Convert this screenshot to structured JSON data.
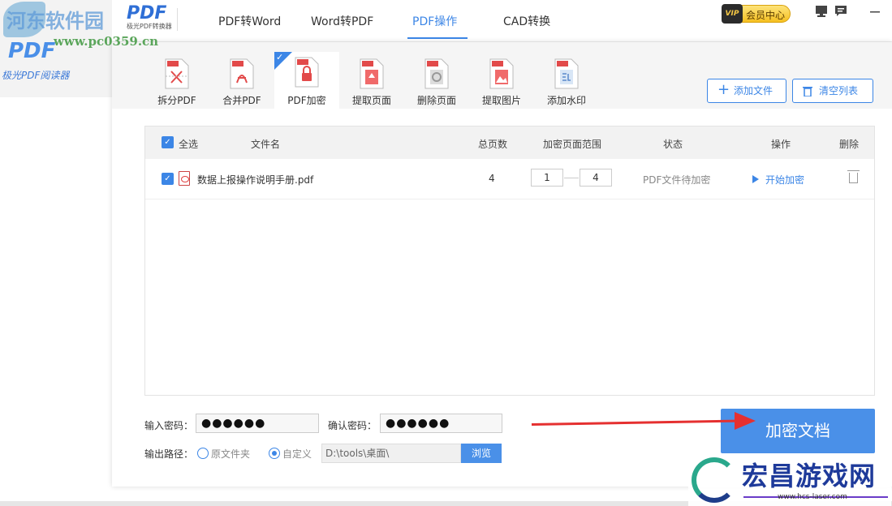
{
  "watermarks": {
    "site_name": "河东软件园",
    "site_url": "www.pc0359.cn",
    "game_site": "宏昌游戏网",
    "game_url": "www.hcs-laser.com"
  },
  "background_app": {
    "logo": "PDF",
    "title": "极光PDF阅读器"
  },
  "header": {
    "brand_logo": "PDF",
    "brand_sub": "极光PDF转换器",
    "tabs": [
      {
        "label": "PDF转Word"
      },
      {
        "label": "Word转PDF"
      },
      {
        "label": "PDF操作"
      },
      {
        "label": "CAD转换"
      }
    ],
    "active_tab": "PDF操作",
    "vip_badge": "VIP",
    "vip_label": "会员中心",
    "window_controls": [
      "monitor-icon",
      "message-icon",
      "minimize-icon"
    ]
  },
  "tools": [
    {
      "label": "拆分PDF",
      "icon": "split-pdf-icon"
    },
    {
      "label": "合并PDF",
      "icon": "merge-pdf-icon"
    },
    {
      "label": "PDF加密",
      "icon": "encrypt-pdf-icon"
    },
    {
      "label": "提取页面",
      "icon": "extract-page-icon"
    },
    {
      "label": "删除页面",
      "icon": "delete-page-icon"
    },
    {
      "label": "提取图片",
      "icon": "extract-image-icon"
    },
    {
      "label": "添加水印",
      "icon": "add-watermark-icon"
    }
  ],
  "active_tool": "PDF加密",
  "actions": {
    "add_file": "添加文件",
    "clear_list": "清空列表"
  },
  "table": {
    "headers": {
      "select_all": "全选",
      "filename": "文件名",
      "total_pages": "总页数",
      "range": "加密页面范围",
      "status": "状态",
      "action": "操作",
      "delete": "删除"
    },
    "rows": [
      {
        "checked": true,
        "filename": "数据上报操作说明手册.pdf",
        "pages": "4",
        "range_from": "1",
        "range_to": "4",
        "status": "PDF文件待加密",
        "action": "开始加密"
      }
    ]
  },
  "form": {
    "password_label": "输入密码：",
    "password_value": "●●●●●●",
    "confirm_label": "确认密码：",
    "confirm_value": "●●●●●●",
    "output_label": "输出路径：",
    "option_original": "原文件夹",
    "option_custom": "自定义",
    "selected_option": "自定义",
    "path_value": "D:\\tools\\桌面\\",
    "browse": "浏览"
  },
  "primary_button": "加密文档",
  "colors": {
    "accent": "#3c86e6",
    "primary_button": "#4a90e8",
    "annotation_arrow": "#e53030"
  }
}
